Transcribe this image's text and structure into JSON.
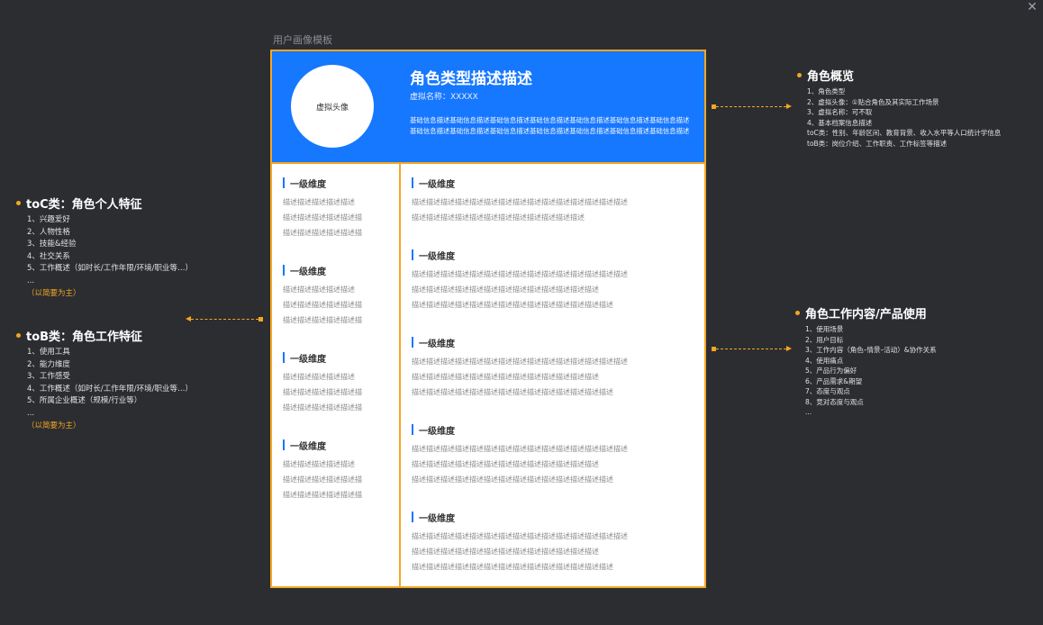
{
  "canvas_label": "用户画像模板",
  "header": {
    "avatar_label": "虚拟头像",
    "role_title": "角色类型描述描述",
    "virtual_name": "虚拟名称：XXXXX",
    "basic_info": "基础信息描述基础信息描述基础信息描述基础信息描述基础信息描述基础信息描述基础信息描述基础信息描述基础信息描述基础信息描述基础信息描述基础信息描述基础信息描述基础信息描述"
  },
  "left_dims": [
    {
      "title": "一级维度",
      "lines": [
        "描述描述描述描述描述",
        "描述描述描述描述描述描",
        "描述描述描述描述描述描"
      ]
    },
    {
      "title": "一级维度",
      "lines": [
        "描述描述描述描述描述",
        "描述描述描述描述描述描",
        "描述描述描述描述描述描"
      ]
    },
    {
      "title": "一级维度",
      "lines": [
        "描述描述描述描述描述",
        "描述描述描述描述描述描",
        "描述描述描述描述描述描"
      ]
    },
    {
      "title": "一级维度",
      "lines": [
        "描述描述描述描述描述",
        "描述描述描述描述描述描",
        "描述描述描述描述描述描"
      ]
    }
  ],
  "right_dims": [
    {
      "title": "一级维度",
      "lines": [
        "描述描述描述描述描述描述描述描述描述描述描述描述描述描述描述",
        "描述描述描述描述描述描述描述描述描述描述描述描述"
      ]
    },
    {
      "title": "一级维度",
      "lines": [
        "描述描述描述描述描述描述描述描述描述描述描述描述描述描述描述",
        "描述描述描述描述描述描述描述描述描述描述描述描述描述",
        "描述描述描述描述描述描述描述描述描述描述描述描述描述描述"
      ]
    },
    {
      "title": "一级维度",
      "lines": [
        "描述描述描述描述描述描述描述描述描述描述描述描述描述描述描述",
        "描述描述描述描述描述描述描述描述描述描述描述描述描述",
        "描述描述描述描述描述描述描述描述描述描述描述描述描述描述"
      ]
    },
    {
      "title": "一级维度",
      "lines": [
        "描述描述描述描述描述描述描述描述描述描述描述描述描述描述描述",
        "描述描述描述描述描述描述描述描述描述描述描述描述描述",
        "描述描述描述描述描述描述描述描述描述描述描述描述描述描述"
      ]
    },
    {
      "title": "一级维度",
      "lines": [
        "描述描述描述描述描述描述描述描述描述描述描述描述描述描述描述",
        "描述描述描述描述描述描述描述描述描述描述描述描述描述",
        "描述描述描述描述描述描述描述描述描述描述描述描述描述描述"
      ]
    }
  ],
  "toc": {
    "title": "toC类：角色个人特征",
    "items": [
      "1、兴趣爱好",
      "2、人物性格",
      "3、技能&经验",
      "4、社交关系",
      "5、工作概述（如时长/工作年限/环境/职业等…）",
      "..."
    ],
    "note": "（以简要为主）"
  },
  "tob": {
    "title": "toB类：角色工作特征",
    "items": [
      "1、使用工具",
      "2、能力维度",
      "3、工作感受",
      "4、工作概述（如时长/工作年限/环境/职业等…）",
      "5、所属企业概述（规模/行业等）",
      "..."
    ],
    "note": "（以简要为主）"
  },
  "overview": {
    "title": "角色概览",
    "items": [
      "1、角色类型",
      "2、虚拟头像：①贴合角色及其实际工作场景",
      "3、虚拟名称：可不取",
      "4、基本档案信息描述",
      "toC类：性别、年龄区间、教育背景、收入水平等人口统计学信息",
      "toB类：岗位介绍、工作职责、工作标签等描述"
    ]
  },
  "work": {
    "title": "角色工作内容/产品使用",
    "items": [
      "1、使用场景",
      "2、用户目标",
      "3、工作内容（角色–情景–活动）&协作关系",
      "4、使用痛点",
      "5、产品行为偏好",
      "6、产品需求&期望",
      "7、态度与观点",
      "8、竞对态度与观点",
      "..."
    ]
  },
  "colors": {
    "accent": "#f5a623",
    "brand_blue": "#1677ff",
    "background": "#2b2d31"
  }
}
